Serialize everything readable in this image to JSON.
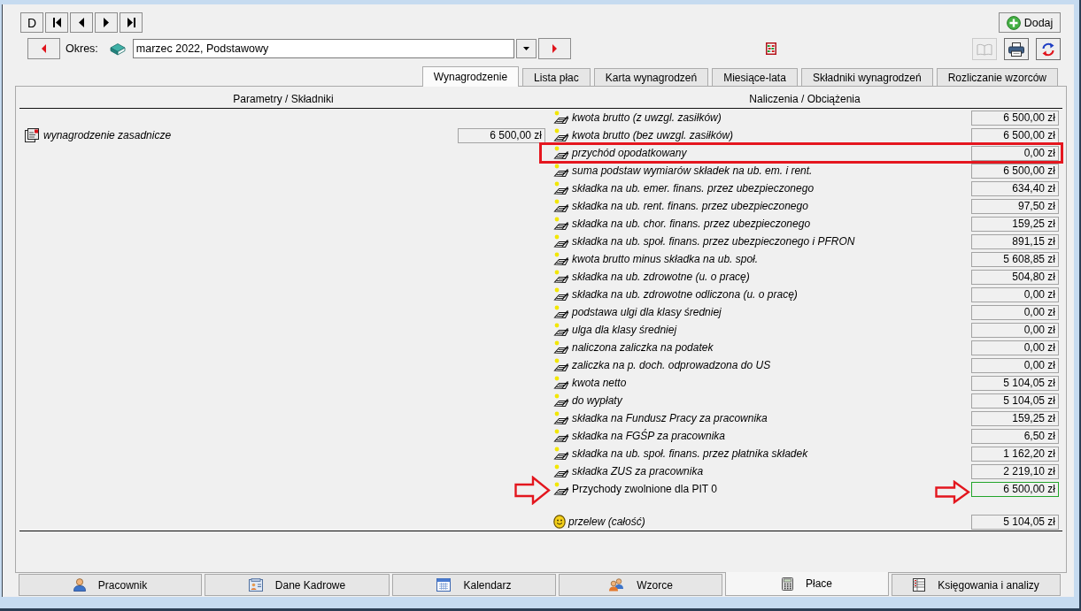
{
  "nav_buttons": [
    {
      "kind": "text",
      "label": "D"
    },
    {
      "kind": "first"
    },
    {
      "kind": "previous"
    },
    {
      "kind": "next"
    },
    {
      "kind": "last"
    }
  ],
  "period": {
    "label": "Okres:",
    "value": "marzec 2022, Podstawowy"
  },
  "add_button": {
    "label": "Dodaj"
  },
  "toolbar": [
    {
      "kind": "book",
      "disabled": true
    },
    {
      "kind": "printer",
      "disabled": false
    },
    {
      "kind": "refresh",
      "disabled": false
    }
  ],
  "tabs": [
    {
      "label": "Wynagrodzenie",
      "selected": true
    },
    {
      "label": "Lista płac",
      "selected": false
    },
    {
      "label": "Karta wynagrodzeń",
      "selected": false
    },
    {
      "label": "Miesiące-lata",
      "selected": false
    },
    {
      "label": "Składniki wynagrodzeń",
      "selected": false
    },
    {
      "label": "Rozliczanie wzorców",
      "selected": false
    }
  ],
  "columns": [
    "Parametry / Składniki",
    "Naliczenia / Obciążenia"
  ],
  "parameters": [
    {
      "label": "wynagrodzenie zasadnicze",
      "value": "6 500,00 zł"
    }
  ],
  "charges": [
    {
      "label": "kwota brutto (z uwzgl. zasiłków)",
      "value": "6 500,00 zł",
      "kind": "italic",
      "framed": false,
      "arrow_marked": false,
      "selected": false
    },
    {
      "label": "kwota brutto (bez uwzgl. zasiłków)",
      "value": "6 500,00 zł",
      "kind": "italic",
      "framed": false,
      "arrow_marked": false,
      "selected": false
    },
    {
      "label": "przychód opodatkowany",
      "value": "0,00 zł",
      "kind": "italic",
      "framed": true,
      "arrow_marked": false,
      "selected": false
    },
    {
      "label": "suma podstaw wymiarów składek na ub. em. i rent.",
      "value": "6 500,00 zł",
      "kind": "italic",
      "framed": false,
      "arrow_marked": false,
      "selected": false
    },
    {
      "label": "składka na ub. emer. finans. przez ubezpieczonego",
      "value": "634,40 zł",
      "kind": "italic",
      "framed": false,
      "arrow_marked": false,
      "selected": false
    },
    {
      "label": "składka na ub. rent. finans. przez ubezpieczonego",
      "value": "97,50 zł",
      "kind": "italic",
      "framed": false,
      "arrow_marked": false,
      "selected": false
    },
    {
      "label": "składka na ub. chor. finans. przez ubezpieczonego",
      "value": "159,25 zł",
      "kind": "italic",
      "framed": false,
      "arrow_marked": false,
      "selected": false
    },
    {
      "label": "składka na ub. społ. finans. przez ubezpieczonego i PFRON",
      "value": "891,15 zł",
      "kind": "italic",
      "framed": false,
      "arrow_marked": false,
      "selected": false
    },
    {
      "label": "kwota brutto minus składka na ub. społ.",
      "value": "5 608,85 zł",
      "kind": "italic",
      "framed": false,
      "arrow_marked": false,
      "selected": false
    },
    {
      "label": "składka na ub. zdrowotne (u. o pracę)",
      "value": "504,80 zł",
      "kind": "italic",
      "framed": false,
      "arrow_marked": false,
      "selected": false
    },
    {
      "label": "składka na ub. zdrowotne odliczona (u. o pracę)",
      "value": "0,00 zł",
      "kind": "italic",
      "framed": false,
      "arrow_marked": false,
      "selected": false
    },
    {
      "label": "podstawa ulgi dla klasy średniej",
      "value": "0,00 zł",
      "kind": "italic",
      "framed": false,
      "arrow_marked": false,
      "selected": false
    },
    {
      "label": "ulga dla klasy średniej",
      "value": "0,00 zł",
      "kind": "italic",
      "framed": false,
      "arrow_marked": false,
      "selected": false
    },
    {
      "label": "naliczona zaliczka na podatek",
      "value": "0,00 zł",
      "kind": "italic",
      "framed": false,
      "arrow_marked": false,
      "selected": false
    },
    {
      "label": "zaliczka na p. doch. odprowadzona do US",
      "value": "0,00 zł",
      "kind": "italic",
      "framed": false,
      "arrow_marked": false,
      "selected": false
    },
    {
      "label": "kwota netto",
      "value": "5 104,05 zł",
      "kind": "italic",
      "framed": false,
      "arrow_marked": false,
      "selected": false
    },
    {
      "label": "do wypłaty",
      "value": "5 104,05 zł",
      "kind": "italic",
      "framed": false,
      "arrow_marked": false,
      "selected": false
    },
    {
      "label": "składka na Fundusz Pracy za pracownika",
      "value": "159,25 zł",
      "kind": "italic",
      "framed": false,
      "arrow_marked": false,
      "selected": false
    },
    {
      "label": "składka na FGŚP za pracownika",
      "value": "6,50 zł",
      "kind": "italic",
      "framed": false,
      "arrow_marked": false,
      "selected": false
    },
    {
      "label": "składka na ub. społ. finans. przez płatnika składek",
      "value": "1 162,20 zł",
      "kind": "italic",
      "framed": false,
      "arrow_marked": false,
      "selected": false
    },
    {
      "label": "składka ZUS za pracownika",
      "value": "2 219,10 zł",
      "kind": "italic",
      "framed": false,
      "arrow_marked": false,
      "selected": false
    },
    {
      "label": "Przychody zwolnione dla PIT 0",
      "value": "6 500,00 zł",
      "kind": "plain",
      "framed": false,
      "arrow_marked": true,
      "selected": true
    }
  ],
  "transfer": {
    "label": "przelew (całość)",
    "value": "5 104,05 zł"
  },
  "bottom_tabs": [
    {
      "label": "Pracownik",
      "selected": false
    },
    {
      "label": "Dane Kadrowe",
      "selected": false
    },
    {
      "label": "Kalendarz",
      "selected": false
    },
    {
      "label": "Wzorce",
      "selected": false
    },
    {
      "label": "Płace",
      "selected": true
    },
    {
      "label": "Księgowania i analizy",
      "selected": false
    }
  ]
}
